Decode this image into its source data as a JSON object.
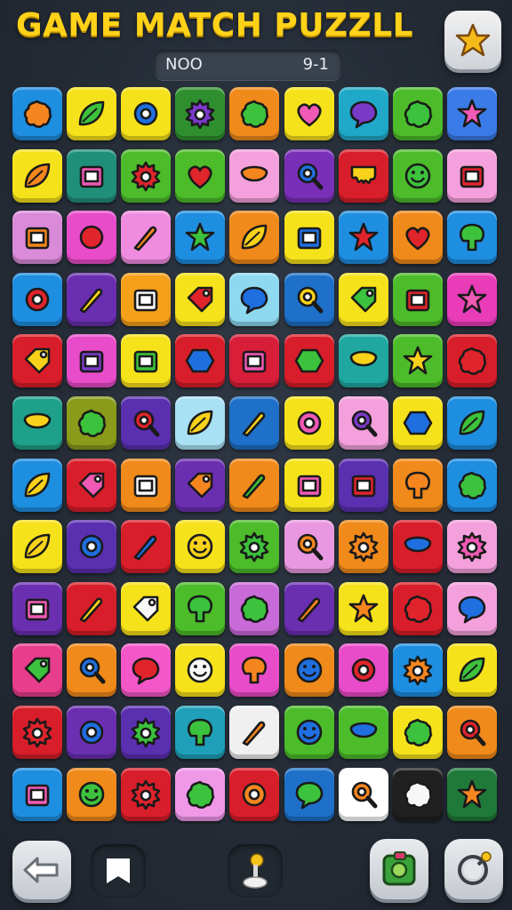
{
  "header": {
    "title": "GAME MATCH PUZZLL",
    "level_label": "NOO",
    "level_value": "9-1",
    "star_button": "star-icon"
  },
  "board": {
    "columns": 9,
    "rows": 12,
    "tiles": [
      {
        "color": "#1e8ee0",
        "icon": "orange-blob"
      },
      {
        "color": "#f6e21a",
        "icon": "green-leaf"
      },
      {
        "color": "#f6e21a",
        "icon": "blue-ring"
      },
      {
        "color": "#2f8f2f",
        "icon": "purple-gear"
      },
      {
        "color": "#f08a1a",
        "icon": "green-blob"
      },
      {
        "color": "#f6e21a",
        "icon": "pink-heart"
      },
      {
        "color": "#20a8c8",
        "icon": "purple-bubble"
      },
      {
        "color": "#4cbc2a",
        "icon": "green-cloud"
      },
      {
        "color": "#3a7be8",
        "icon": "pink-star"
      },
      {
        "color": "#f6e21a",
        "icon": "orange-leaf"
      },
      {
        "color": "#1f8f7a",
        "icon": "pink-box"
      },
      {
        "color": "#4cbc2a",
        "icon": "red-flower"
      },
      {
        "color": "#4cbc2a",
        "icon": "red-heart"
      },
      {
        "color": "#f4a0dc",
        "icon": "orange-bowl"
      },
      {
        "color": "#7a2fb8",
        "icon": "blue-pin"
      },
      {
        "color": "#d81e2a",
        "icon": "yellow-drip"
      },
      {
        "color": "#4cbc2a",
        "icon": "green-swirl"
      },
      {
        "color": "#f4a0dc",
        "icon": "red-robot"
      },
      {
        "color": "#d98ad8",
        "icon": "orange-frame"
      },
      {
        "color": "#e84cc8",
        "icon": "red-bag"
      },
      {
        "color": "#f08ce0",
        "icon": "orange-stick"
      },
      {
        "color": "#1e8ee0",
        "icon": "green-star"
      },
      {
        "color": "#f08a1a",
        "icon": "yellow-leaf"
      },
      {
        "color": "#f6e21a",
        "icon": "blue-robot"
      },
      {
        "color": "#1e8ee0",
        "icon": "red-star"
      },
      {
        "color": "#f08a1a",
        "icon": "red-heart"
      },
      {
        "color": "#1e8ee0",
        "icon": "green-tree"
      },
      {
        "color": "#1e8ee0",
        "icon": "red-ring"
      },
      {
        "color": "#6a2fb0",
        "icon": "yellow-brush"
      },
      {
        "color": "#f6a01a",
        "icon": "white-box"
      },
      {
        "color": "#f6e21a",
        "icon": "red-gem"
      },
      {
        "color": "#8ed8f0",
        "icon": "blue-bubble"
      },
      {
        "color": "#1e70c8",
        "icon": "yellow-magnifier"
      },
      {
        "color": "#f6e21a",
        "icon": "green-tag"
      },
      {
        "color": "#4cbc2a",
        "icon": "red-frame"
      },
      {
        "color": "#e83cb8",
        "icon": "pink-star"
      },
      {
        "color": "#d81e2a",
        "icon": "yellow-block"
      },
      {
        "color": "#e84cc8",
        "icon": "purple-cube"
      },
      {
        "color": "#f6e21a",
        "icon": "green-frame"
      },
      {
        "color": "#d81e2a",
        "icon": "blue-hex"
      },
      {
        "color": "#d81e38",
        "icon": "pink-box"
      },
      {
        "color": "#d81e2a",
        "icon": "green-apple"
      },
      {
        "color": "#20a8a0",
        "icon": "yellow-jar"
      },
      {
        "color": "#4cbc2a",
        "icon": "yellow-star"
      },
      {
        "color": "#d81e2a",
        "icon": "red-blob"
      },
      {
        "color": "#1fa08a",
        "icon": "yellow-bowl"
      },
      {
        "color": "#8a9a1a",
        "icon": "green-splat"
      },
      {
        "color": "#5a2fb0",
        "icon": "red-pin"
      },
      {
        "color": "#a8e0f4",
        "icon": "yellow-leaf"
      },
      {
        "color": "#1e70c8",
        "icon": "yellow-brush"
      },
      {
        "color": "#f6e21a",
        "icon": "pink-ring"
      },
      {
        "color": "#f4a0dc",
        "icon": "purple-magnifier"
      },
      {
        "color": "#f6e21a",
        "icon": "blue-bar"
      },
      {
        "color": "#1e8ee0",
        "icon": "green-leaf"
      },
      {
        "color": "#1e8ee0",
        "icon": "yellow-leaf"
      },
      {
        "color": "#d81e2a",
        "icon": "pink-shoe"
      },
      {
        "color": "#f08a1a",
        "icon": "white-box"
      },
      {
        "color": "#6a2fb0",
        "icon": "orange-flag"
      },
      {
        "color": "#f08a1a",
        "icon": "green-brush"
      },
      {
        "color": "#f6e21a",
        "icon": "pink-robot"
      },
      {
        "color": "#5a2fb0",
        "icon": "red-cube"
      },
      {
        "color": "#f08a1a",
        "icon": "orange-hand"
      },
      {
        "color": "#1e8ee0",
        "icon": "green-splat"
      },
      {
        "color": "#f6e21a",
        "icon": "yellow-leaf"
      },
      {
        "color": "#5a2fb0",
        "icon": "blue-ring"
      },
      {
        "color": "#d81e2a",
        "icon": "blue-stick"
      },
      {
        "color": "#f6e21a",
        "icon": "yellow-smile"
      },
      {
        "color": "#4cbc2a",
        "icon": "green-gear"
      },
      {
        "color": "#e898e0",
        "icon": "orange-magnifier"
      },
      {
        "color": "#f08a1a",
        "icon": "orange-gear"
      },
      {
        "color": "#d81e2a",
        "icon": "blue-barrel"
      },
      {
        "color": "#f4a0dc",
        "icon": "pink-flower"
      },
      {
        "color": "#6a2fb0",
        "icon": "pink-card"
      },
      {
        "color": "#d81e2a",
        "icon": "yellow-bandage"
      },
      {
        "color": "#f6e21a",
        "icon": "white-plane"
      },
      {
        "color": "#4cbc2a",
        "icon": "green-shield"
      },
      {
        "color": "#c86ad8",
        "icon": "green-blob"
      },
      {
        "color": "#6a2fb0",
        "icon": "orange-candy"
      },
      {
        "color": "#f6e21a",
        "icon": "orange-star"
      },
      {
        "color": "#d81e2a",
        "icon": "red-blob"
      },
      {
        "color": "#f4a0dc",
        "icon": "blue-balloon"
      },
      {
        "color": "#e83c8c",
        "icon": "green-flag"
      },
      {
        "color": "#f08a1a",
        "icon": "blue-pin"
      },
      {
        "color": "#f458c8",
        "icon": "red-balloon"
      },
      {
        "color": "#f6e21a",
        "icon": "white-cookie"
      },
      {
        "color": "#e84cc8",
        "icon": "orange-mushroom"
      },
      {
        "color": "#f08a1a",
        "icon": "blue-ball"
      },
      {
        "color": "#e84cc8",
        "icon": "red-ring"
      },
      {
        "color": "#1e8ee0",
        "icon": "orange-gear"
      },
      {
        "color": "#f6e21a",
        "icon": "green-leaf"
      },
      {
        "color": "#d81e2a",
        "icon": "red-gear"
      },
      {
        "color": "#6a2fb0",
        "icon": "blue-ring"
      },
      {
        "color": "#5a2fb0",
        "icon": "green-gear"
      },
      {
        "color": "#1fa0b8",
        "icon": "green-tree"
      },
      {
        "color": "#f0f0f0",
        "icon": "orange-cone"
      },
      {
        "color": "#4cbc2a",
        "icon": "blue-clock"
      },
      {
        "color": "#4cbc2a",
        "icon": "blue-ufo"
      },
      {
        "color": "#f6e21a",
        "icon": "green-blob"
      },
      {
        "color": "#f08a1a",
        "icon": "red-pin"
      },
      {
        "color": "#1e8ee0",
        "icon": "pink-box"
      },
      {
        "color": "#f08a1a",
        "icon": "green-swirl"
      },
      {
        "color": "#d81e2a",
        "icon": "red-gear"
      },
      {
        "color": "#f098e8",
        "icon": "green-blob"
      },
      {
        "color": "#d81e2a",
        "icon": "orange-ring"
      },
      {
        "color": "#1e70c8",
        "icon": "green-bubble"
      },
      {
        "color": "#ffffff",
        "icon": "orange-magnifier"
      },
      {
        "color": "#202020",
        "icon": "white-splat"
      },
      {
        "color": "#1f7a3a",
        "icon": "orange-star"
      }
    ]
  },
  "footer": {
    "back_button": "undo-icon",
    "flag_button": "flag-icon",
    "joystick_button": "joystick-icon",
    "map_button": "map-icon",
    "hint_button": "hint-icon"
  }
}
